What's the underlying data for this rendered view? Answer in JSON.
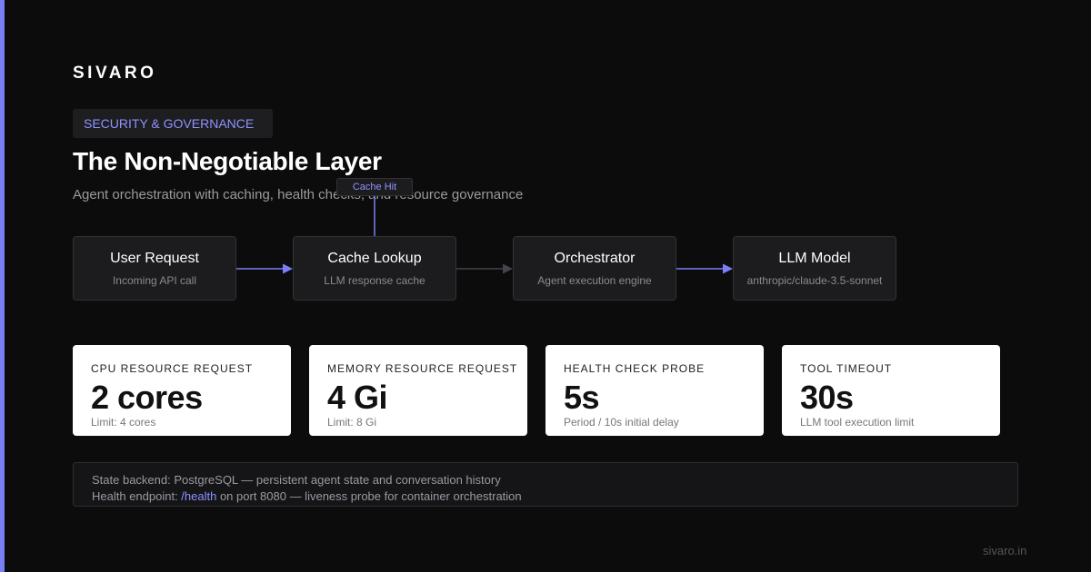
{
  "brand": "SIVARO",
  "badge": "SECURITY & GOVERNANCE",
  "title": "The Non-Negotiable Layer",
  "subtitle": "Agent orchestration with caching, health checks, and resource governance",
  "flow": {
    "nodes": [
      {
        "title": "User Request",
        "subtitle": "Incoming API call"
      },
      {
        "title": "Cache Lookup",
        "subtitle": "LLM response cache"
      },
      {
        "title": "Orchestrator",
        "subtitle": "Agent execution engine"
      },
      {
        "title": "LLM Model",
        "subtitle": "anthropic/claude-3.5-sonnet"
      }
    ],
    "cache_hit_label": "Cache Hit"
  },
  "metrics": [
    {
      "label": "CPU RESOURCE REQUEST",
      "value": "2 cores",
      "sub": "Limit: 4 cores"
    },
    {
      "label": "MEMORY RESOURCE REQUEST",
      "value": "4 Gi",
      "sub": "Limit: 8 Gi"
    },
    {
      "label": "HEALTH CHECK PROBE",
      "value": "5s",
      "sub": "Period / 10s initial delay"
    },
    {
      "label": "TOOL TIMEOUT",
      "value": "30s",
      "sub": "LLM tool execution limit"
    }
  ],
  "info": {
    "line1": "State backend: PostgreSQL — persistent agent state and conversation history",
    "line2_prefix": "Health endpoint: ",
    "line2_link": "/health",
    "line2_suffix": " on port 8080 — liveness probe for container orchestration"
  },
  "footer": "sivaro.in",
  "colors": {
    "accent": "#7b7ff5",
    "accent_text": "#8e92ff",
    "background": "#0c0c0c",
    "node_bg": "#1c1c1e",
    "card_bg": "#ffffff"
  }
}
